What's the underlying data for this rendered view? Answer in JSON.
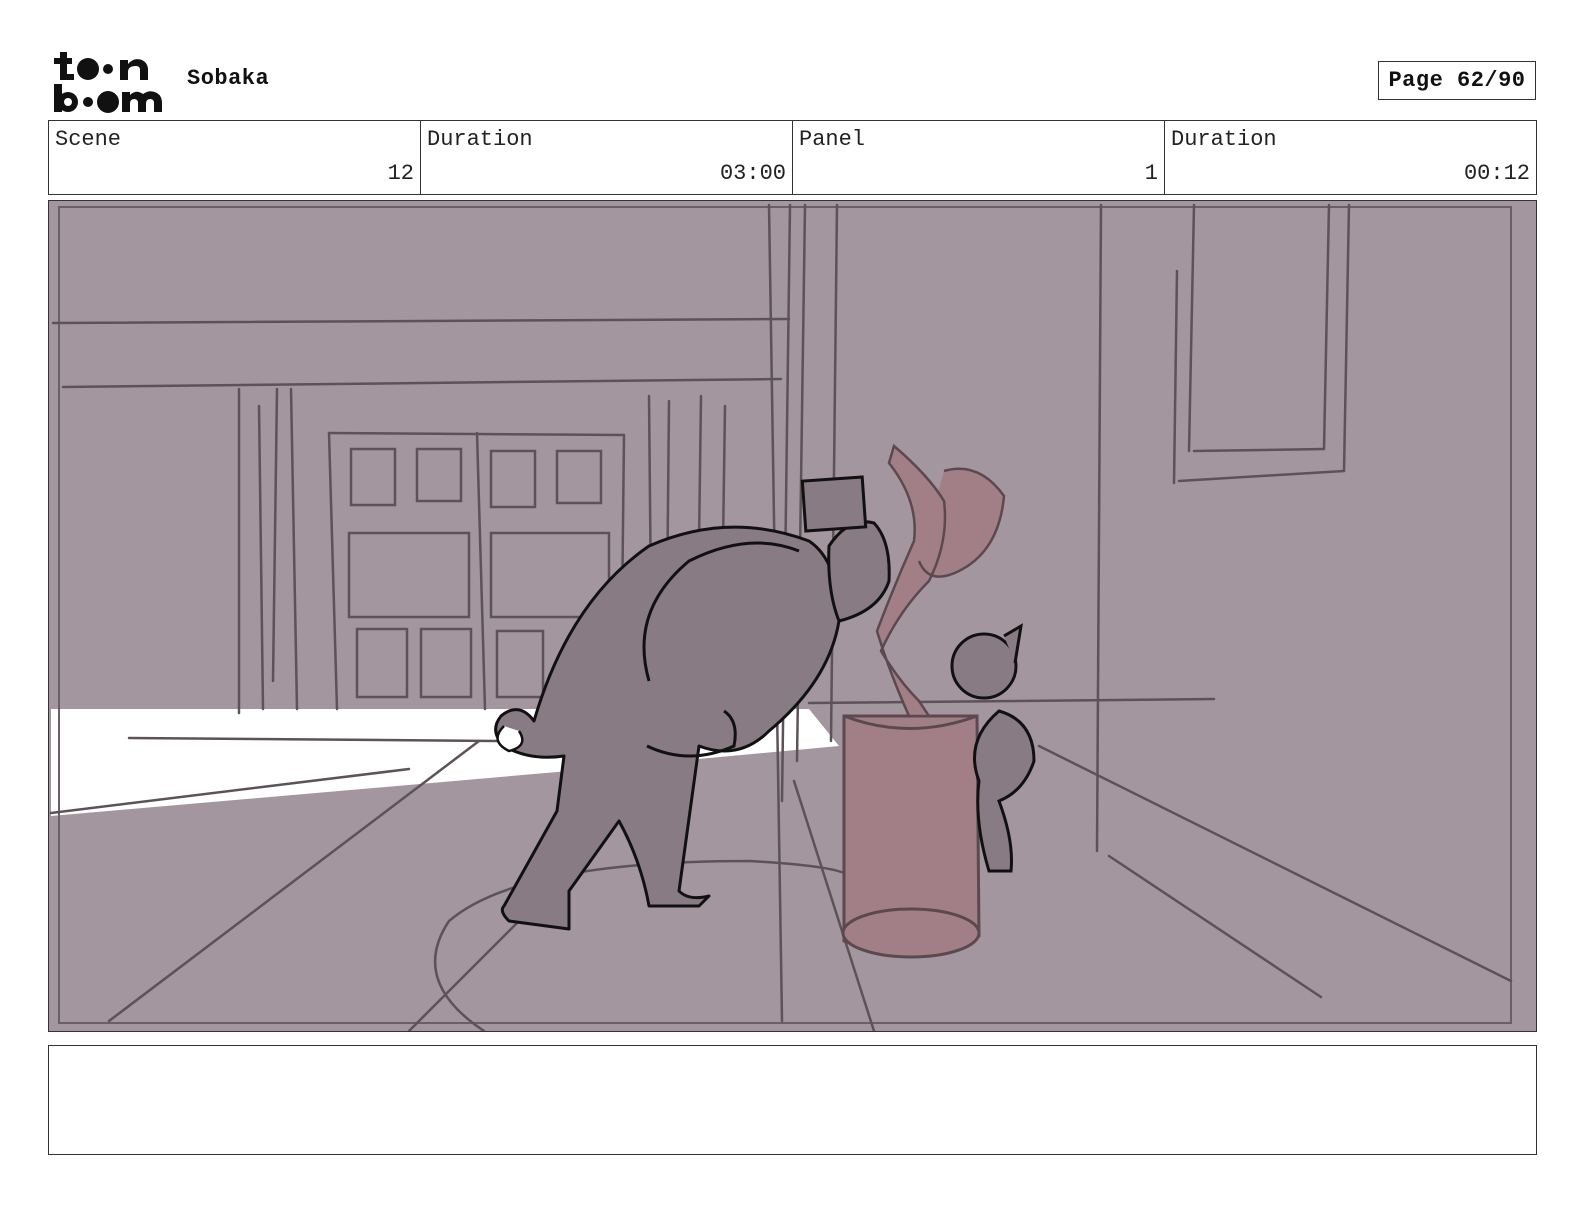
{
  "header": {
    "logo_text": "toon boom",
    "project_title": "Sobaka",
    "page_label": "Page 62/90"
  },
  "info": {
    "scene_label": "Scene",
    "scene_value": "12",
    "scene_duration_label": "Duration",
    "scene_duration_value": "03:00",
    "panel_label": "Panel",
    "panel_value": "1",
    "panel_duration_label": "Duration",
    "panel_duration_value": "00:12"
  },
  "panel": {
    "description": ""
  },
  "notes": {
    "text": ""
  },
  "colors": {
    "background_fill": "#a4969f",
    "character_fill": "#887b84",
    "prop_fill": "#a27f86",
    "line": "#5c5258"
  }
}
